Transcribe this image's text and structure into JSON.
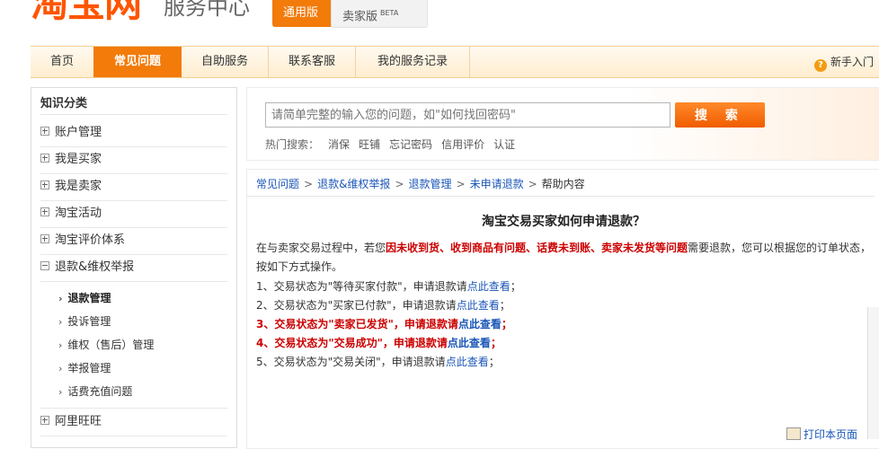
{
  "header": {
    "logo_text": "淘宝网",
    "subtitle": "服务中心",
    "version_general": "通用版",
    "version_seller": "卖家版",
    "version_seller_badge": "BETA"
  },
  "nav": {
    "items": [
      "首页",
      "常见问题",
      "自助服务",
      "联系客服",
      "我的服务记录"
    ],
    "active": "常见问题",
    "help_label": "新手入门"
  },
  "sidebar": {
    "title": "知识分类",
    "categories": [
      "账户管理",
      "我是买家",
      "我是卖家",
      "淘宝活动",
      "淘宝评价体系",
      "退款&维权举报",
      "阿里旺旺"
    ],
    "expanded": "退款&维权举报",
    "sub_items": [
      "退款管理",
      "投诉管理",
      "维权（售后）管理",
      "举报管理",
      "话费充值问题"
    ],
    "sub_active": "退款管理"
  },
  "search": {
    "placeholder": "请简单完整的输入您的问题，如\"如何找回密码\"",
    "button": "搜 索",
    "hot_label": "热门搜索：",
    "hot_terms": [
      "消保",
      "旺铺",
      "忘记密码",
      "信用评价",
      "认证"
    ]
  },
  "breadcrumb": [
    "常见问题",
    "退款&维权举报",
    "退款管理",
    "未申请退款",
    "帮助内容"
  ],
  "article": {
    "title": "淘宝交易买家如何申请退款？",
    "intro_before": "在与卖家交易过程中，若您",
    "intro_bold": "因未收到货、收到商品有问题、话费未到账、卖家未发货等问题",
    "intro_after": "需要退款，您可以根据您的订单状态，按如下方式操作。",
    "steps": [
      {
        "text": "1、交易状态为\"等待买家付款\"，申请退款请",
        "link": "点此查看",
        "end": "；"
      },
      {
        "text": "2、交易状态为\"买家已付款\"，申请退款请",
        "link": "点此查看",
        "end": "；"
      },
      {
        "text": "3、交易状态为\"卖家已发货\"，申请退款请",
        "link": "点此查看",
        "end": "；"
      },
      {
        "text": "4、交易状态为\"交易成功\"，申请退款请",
        "link": "点此查看",
        "end": "；"
      },
      {
        "text": "5、交易状态为\"交易关闭\"，申请退款请",
        "link": "点此查看",
        "end": "；"
      }
    ],
    "print_label": "打印本页面"
  },
  "colors": {
    "brand_orange": "#f27b0a",
    "link_blue": "#1a56b8",
    "emphasis_red": "#cc0000"
  }
}
